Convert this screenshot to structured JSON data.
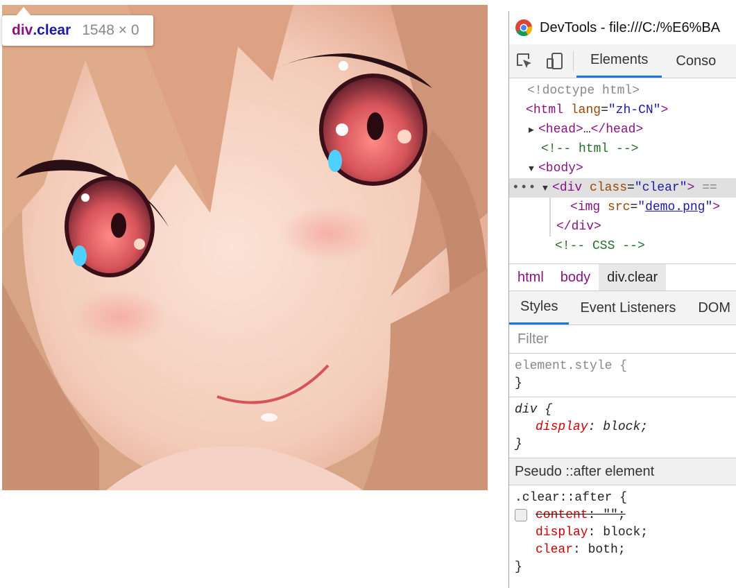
{
  "tooltip": {
    "tag": "div",
    "cls": ".clear",
    "size": "1548 × 0"
  },
  "devtools": {
    "title": "DevTools - file:///C:/%E6%BA",
    "tabs": [
      "Elements",
      "Conso"
    ],
    "dom": {
      "doctype": "<!doctype html>",
      "html_open": {
        "tag": "html",
        "attr": "lang",
        "val": "\"zh-CN\""
      },
      "head": {
        "open": "<head>",
        "ellipsis": "…",
        "close": "</head>"
      },
      "comment1": "<!-- html -->",
      "body": "<body>",
      "div": {
        "tag": "div",
        "attr": "class",
        "val": "\"clear\"",
        "suffix": "== "
      },
      "img": {
        "tag": "img",
        "attr": "src",
        "val": "demo.png"
      },
      "div_close": "</div>",
      "comment2": "<!-- CSS -->",
      "dots": "•••"
    },
    "breadcrumbs": [
      "html",
      "body",
      "div.clear"
    ],
    "subtabs": [
      "Styles",
      "Event Listeners",
      "DOM"
    ],
    "filter_placeholder": "Filter",
    "rules": {
      "element_style": {
        "selector": "element.style {",
        "close": "}"
      },
      "div": {
        "selector": "div {",
        "prop": "display",
        "val": "block;",
        "close": "}"
      },
      "pseudo_header": "Pseudo ::after element",
      "clear_after": {
        "selector": ".clear::after {",
        "props": [
          {
            "name": "content",
            "val": "\"\";",
            "disabled": true
          },
          {
            "name": "display",
            "val": "block;",
            "disabled": false
          },
          {
            "name": "clear",
            "val": "both;",
            "disabled": false
          }
        ],
        "close": "}"
      }
    }
  },
  "colors": {
    "accent": "#1a73e8",
    "tag": "#881280",
    "attr": "#994500",
    "value": "#1a1aa6",
    "comment": "#236e25",
    "prop": "#c80000"
  }
}
